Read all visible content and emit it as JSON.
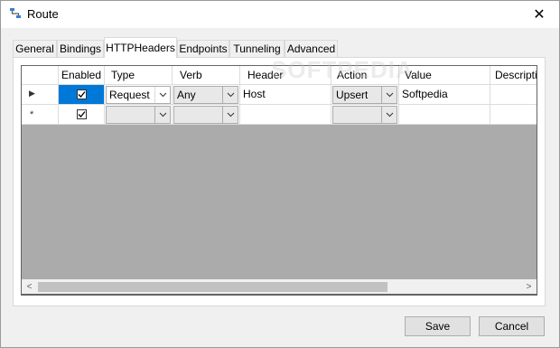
{
  "window": {
    "title": "Route",
    "close_glyph": "✕"
  },
  "tabs": [
    "General",
    "Bindings",
    "HTTPHeaders",
    "Endpoints",
    "Tunneling",
    "Advanced"
  ],
  "active_tab": "HTTPHeaders",
  "grid": {
    "columns": [
      "Enabled",
      "Type",
      "Verb",
      "Header",
      "Action",
      "Value",
      "Descriptio"
    ],
    "rows": [
      {
        "indicator": "▶",
        "enabled": true,
        "type": "Request",
        "verb": "Any",
        "header": "Host",
        "action": "Upsert",
        "value": "Softpedia",
        "description": ""
      },
      {
        "indicator": "*",
        "enabled": true,
        "type": "",
        "verb": "",
        "header": "",
        "action": "",
        "value": "",
        "description": ""
      }
    ]
  },
  "scrollbar": {
    "left_arrow": "<",
    "right_arrow": ">"
  },
  "buttons": {
    "save": "Save",
    "cancel": "Cancel"
  },
  "watermark": "SOFTPEDIA",
  "colors": {
    "selection": "#0078d7",
    "grid_background": "#ababab"
  }
}
